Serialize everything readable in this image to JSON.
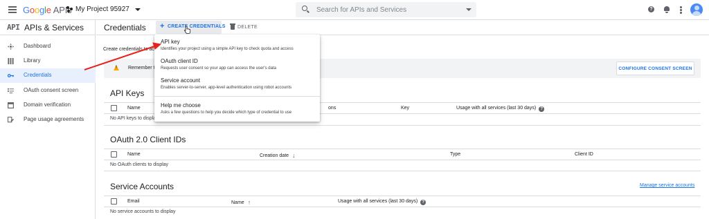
{
  "header": {
    "logo_letters": [
      "G",
      "o",
      "o",
      "g",
      "l",
      "e"
    ],
    "logo_suffix": "APIs",
    "project_name": "My Project 95927",
    "search_placeholder": "Search for APIs and Services",
    "help_glyph": "?"
  },
  "sidebar": {
    "logo": "API",
    "title": "APIs & Services",
    "items": [
      {
        "label": "Dashboard",
        "icon": "dashboard-icon",
        "active": false
      },
      {
        "label": "Library",
        "icon": "library-icon",
        "active": false
      },
      {
        "label": "Credentials",
        "icon": "key-icon",
        "active": true
      },
      {
        "label": "OAuth consent screen",
        "icon": "consent-icon",
        "active": false
      },
      {
        "label": "Domain verification",
        "icon": "domain-icon",
        "active": false
      },
      {
        "label": "Page usage agreements",
        "icon": "agreements-icon",
        "active": false
      }
    ]
  },
  "main": {
    "title": "Credentials",
    "create_plus": "+",
    "create_label": "CREATE CREDENTIALS",
    "delete_label": "DELETE",
    "intro": "Create credentials to ac",
    "banner": {
      "text": "Remember t",
      "button": "CONFIGURE CONSENT SCREEN"
    },
    "api_keys": {
      "title": "API Keys",
      "columns": [
        "Name",
        "ons",
        "Key",
        "Usage with all services (last 30 days)"
      ],
      "empty": "No API keys to displa"
    },
    "oauth": {
      "title": "OAuth 2.0 Client IDs",
      "columns": [
        "Name",
        "Creation date",
        "Type",
        "Client ID"
      ],
      "empty": "No OAuth clients to display"
    },
    "service": {
      "title": "Service Accounts",
      "manage_link": "Manage service accounts",
      "columns": [
        "Email",
        "Name",
        "Usage with all services (last 30 days)"
      ],
      "empty": "No service accounts to display"
    }
  },
  "menu": {
    "items": [
      {
        "title": "API key",
        "desc": "Identifies your project using a simple API key to check quota and access"
      },
      {
        "title": "OAuth client ID",
        "desc": "Requests user consent so your app can access the user's data"
      },
      {
        "title": "Service account",
        "desc": "Enables server-to-server, app-level authentication using robot accounts"
      },
      {
        "title": "Help me choose",
        "desc": "Asks a few questions to help you decide which type of credential to use"
      }
    ]
  },
  "colors": {
    "accent": "#1a73e8",
    "annotation_arrow": "#e8221b",
    "warning": "#f9ab00",
    "active_nav_bg": "#e8f0fe"
  }
}
